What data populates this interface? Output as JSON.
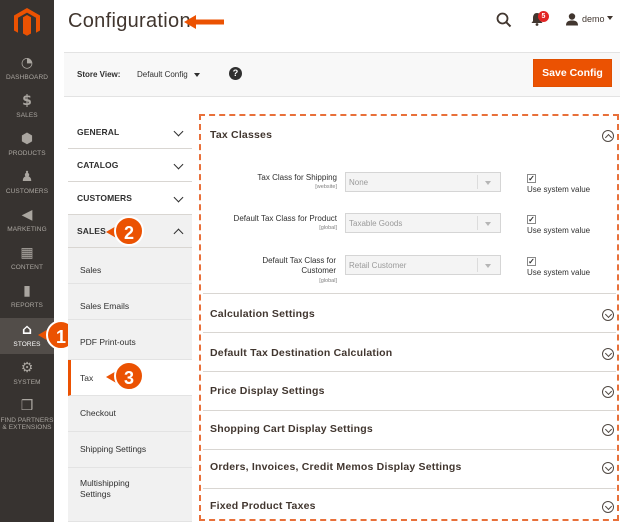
{
  "nav": {
    "items": [
      {
        "label": "DASHBOARD",
        "icon": "dashboard-icon"
      },
      {
        "label": "SALES",
        "icon": "dollar-icon"
      },
      {
        "label": "PRODUCTS",
        "icon": "cube-icon"
      },
      {
        "label": "CUSTOMERS",
        "icon": "person-icon"
      },
      {
        "label": "MARKETING",
        "icon": "megaphone-icon"
      },
      {
        "label": "CONTENT",
        "icon": "layout-icon"
      },
      {
        "label": "REPORTS",
        "icon": "bar-chart-icon"
      },
      {
        "label": "STORES",
        "icon": "store-icon"
      },
      {
        "label": "SYSTEM",
        "icon": "gear-icon"
      },
      {
        "label": "FIND PARTNERS & EXTENSIONS",
        "icon": "box-icon"
      }
    ]
  },
  "header": {
    "title": "Configuration",
    "notifications_count": "5",
    "user_name": "demo"
  },
  "store_view": {
    "label": "Store View:",
    "value": "Default Config",
    "help": "?"
  },
  "actions": {
    "save_label": "Save Config"
  },
  "tabs": {
    "general": "GENERAL",
    "catalog": "CATALOG",
    "customers": "CUSTOMERS",
    "sales": "SALES",
    "sales_items": [
      "Sales",
      "Sales Emails",
      "PDF Print-outs",
      "Tax",
      "Checkout",
      "Shipping Settings",
      "Multishipping Settings"
    ]
  },
  "steps": [
    "1",
    "2",
    "3"
  ],
  "sections": {
    "tax_classes": {
      "title": "Tax Classes",
      "fields": [
        {
          "label": "Tax Class for Shipping",
          "scope": "[website]",
          "value": "None",
          "checkbox_label": "Use system value"
        },
        {
          "label": "Default Tax Class for Product",
          "scope": "[global]",
          "value": "Taxable Goods",
          "checkbox_label": "Use system value"
        },
        {
          "label": "Default Tax Class for Customer",
          "scope": "[global]",
          "value": "Retail Customer",
          "checkbox_label": "Use system value"
        }
      ]
    },
    "collapsed": [
      "Calculation Settings",
      "Default Tax Destination Calculation",
      "Price Display Settings",
      "Shopping Cart Display Settings",
      "Orders, Invoices, Credit Memos Display Settings",
      "Fixed Product Taxes"
    ]
  },
  "colors": {
    "accent": "#eb5202",
    "nav_bg": "#373330"
  }
}
